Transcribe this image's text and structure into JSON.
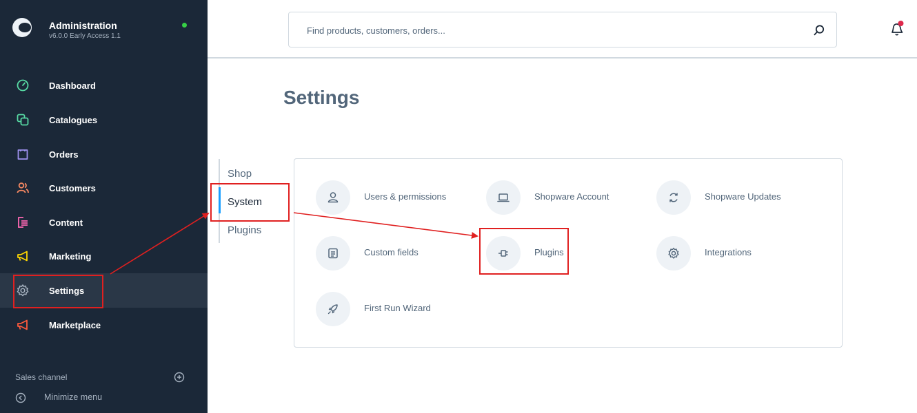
{
  "sidebar": {
    "app_title": "Administration",
    "app_version": "v6.0.0 Early Access 1.1",
    "items": [
      {
        "label": "Dashboard",
        "icon": "dashboard-gauge-icon",
        "color": "#57d9a3"
      },
      {
        "label": "Catalogues",
        "icon": "catalogues-icon",
        "color": "#57d9a3"
      },
      {
        "label": "Orders",
        "icon": "orders-bag-icon",
        "color": "#a092f0"
      },
      {
        "label": "Customers",
        "icon": "customers-icon",
        "color": "#f88962"
      },
      {
        "label": "Content",
        "icon": "content-icon",
        "color": "#ff68b4"
      },
      {
        "label": "Marketing",
        "icon": "marketing-megaphone-icon",
        "color": "#ffd700"
      },
      {
        "label": "Settings",
        "icon": "settings-gear-icon",
        "color": "#a6b2c0"
      },
      {
        "label": "Marketplace",
        "icon": "marketplace-icon",
        "color": "#ff5a3c"
      }
    ],
    "sales_channel_label": "Sales channel",
    "minimize_label": "Minimize menu"
  },
  "search": {
    "placeholder": "Find products, customers, orders..."
  },
  "main": {
    "title": "Settings",
    "subnav": [
      "Shop",
      "System",
      "Plugins"
    ],
    "tiles": [
      {
        "label": "Users & permissions",
        "icon": "user-icon"
      },
      {
        "label": "Shopware Account",
        "icon": "laptop-icon"
      },
      {
        "label": "Shopware Updates",
        "icon": "refresh-icon"
      },
      {
        "label": "Custom fields",
        "icon": "list-document-icon"
      },
      {
        "label": "Plugins",
        "icon": "plugin-icon"
      },
      {
        "label": "Integrations",
        "icon": "gear-icon"
      },
      {
        "label": "First Run Wizard",
        "icon": "rocket-icon"
      }
    ]
  },
  "colors": {
    "sidebar_bg": "#1b2838",
    "accent": "#189eff",
    "annotation": "#e02020",
    "status_online": "#37d046",
    "notification": "#de294c"
  }
}
